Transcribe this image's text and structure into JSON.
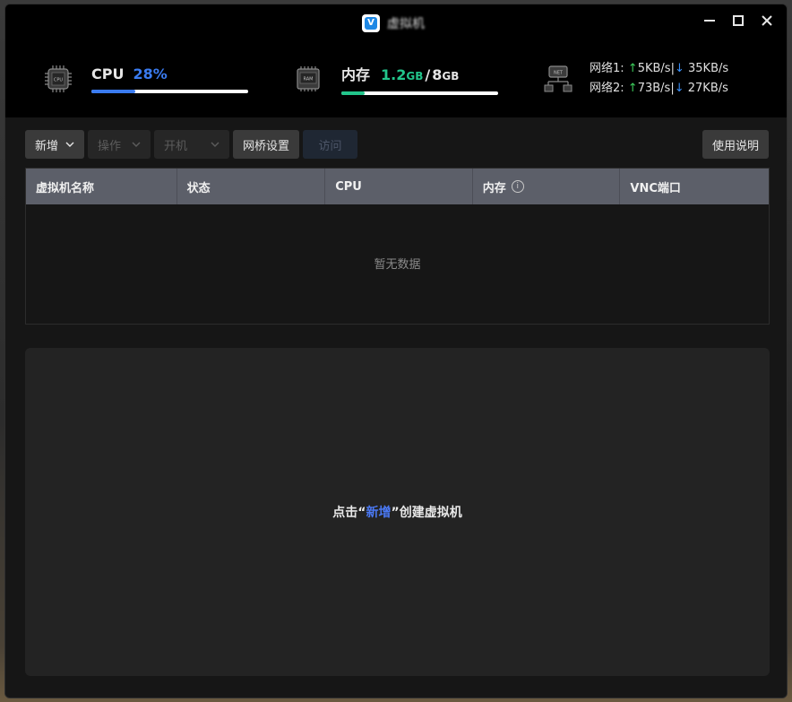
{
  "window": {
    "title": "虚拟机"
  },
  "stats": {
    "cpu": {
      "icon": "cpu-chip-icon",
      "icon_text": "CPU",
      "label": "CPU",
      "value": "28%",
      "fraction": 0.28,
      "color": "#3a7bf0"
    },
    "ram": {
      "icon": "ram-chip-icon",
      "icon_text": "RAM",
      "label": "内存",
      "used": "1.2",
      "used_unit": "GB",
      "sep": "/",
      "total": "8",
      "total_unit": "GB",
      "fraction": 0.15,
      "color": "#22c58b"
    },
    "net": {
      "icon": "network-icon",
      "icon_text": "NET",
      "lines": [
        {
          "label": "网络1:",
          "up": "5KB/s",
          "down": "35KB/s"
        },
        {
          "label": "网络2:",
          "up": "73B/s",
          "down": "27KB/s"
        }
      ],
      "up_arrow": "↑",
      "down_arrow": "↓",
      "sep": "|"
    }
  },
  "toolbar": {
    "add_label": "新增",
    "operate_label": "操作",
    "power_label": "开机",
    "bridge_label": "网桥设置",
    "visit_label": "访问",
    "help_label": "使用说明"
  },
  "table": {
    "columns": [
      "虚拟机名称",
      "状态",
      "CPU",
      "内存",
      "VNC端口"
    ],
    "info_glyph": "i",
    "empty_text": "暂无数据"
  },
  "panel": {
    "hint_prefix": "点击",
    "hint_open_quote": "“",
    "hint_link": "新增",
    "hint_close_quote": "”",
    "hint_suffix": "创建虚拟机"
  },
  "colors": {
    "accent": "#4a78f2",
    "up": "#3ccc5b",
    "down": "#3a8ef6"
  }
}
